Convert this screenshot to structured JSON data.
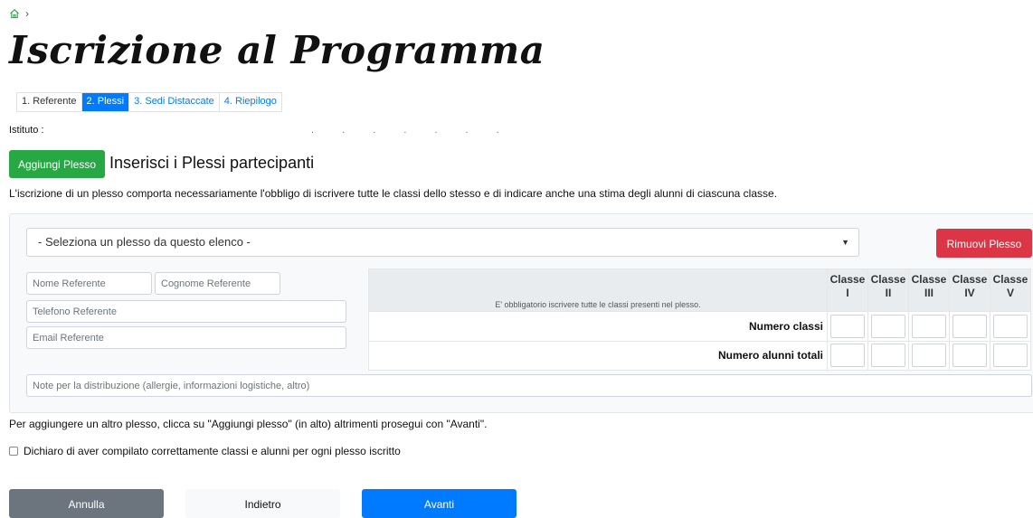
{
  "breadcrumb": {
    "home_icon": "home-icon",
    "separator": "›"
  },
  "page": {
    "title": "Iscrizione al Programma"
  },
  "steps": [
    {
      "label": "1. Referente",
      "state": "done"
    },
    {
      "label": "2. Plessi",
      "state": "active"
    },
    {
      "label": "3. Sedi Distaccate",
      "state": "todo"
    },
    {
      "label": "4. Riepilogo",
      "state": "todo"
    }
  ],
  "istituto": {
    "label": "Istituto :",
    "value": ". . . . . . ."
  },
  "plessi": {
    "add_button": "Aggiungi Plesso",
    "heading": "Inserisci i Plessi partecipanti",
    "notice": "L'iscrizione di un plesso comporta necessariamente l'obbligo di iscrivere tutte le classi dello stesso e di indicare anche una stima degli alunni di ciascuna classe.",
    "select_value": "- Seleziona un plesso da questo elenco -",
    "remove_button": "Rimuovi Plesso",
    "fields": {
      "nome": "Nome Referente",
      "cognome": "Cognome Referente",
      "telefono": "Telefono Referente",
      "email": "Email Referente",
      "note": "Note per la distribuzione (allergie, informazioni logistiche, altro)"
    },
    "grid": {
      "note": "E' obbligatorio iscrivere tutte le classi presenti nel plesso.",
      "column_word": "Classe",
      "columns": [
        "I",
        "II",
        "III",
        "IV",
        "V"
      ],
      "rows": [
        "Numero classi",
        "Numero alunni totali"
      ]
    }
  },
  "footer": {
    "info": "Per aggiungere un altro plesso, clicca su \"Aggiungi plesso\" (in alto) altrimenti prosegui con \"Avanti\".",
    "checkbox_label": "Dichiaro di aver compilato correttamente classi e alunni per ogni plesso iscritto",
    "cancel": "Annulla",
    "back": "Indietro",
    "next": "Avanti"
  },
  "colors": {
    "primary": "#007bff",
    "success": "#28a745",
    "danger": "#dc3545",
    "secondary": "#6c757d"
  }
}
